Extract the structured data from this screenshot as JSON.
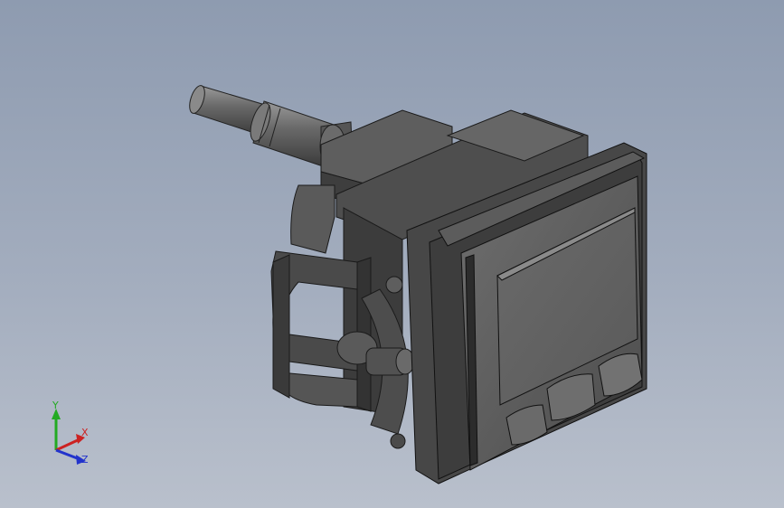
{
  "viewport": {
    "background_top": "#8e9bb0",
    "background_bottom": "#b9c0cc",
    "model_name": ""
  },
  "triad": {
    "x_label": "X",
    "y_label": "Y",
    "z_label": "Z",
    "x_color": "#cc2222",
    "y_color": "#22aa22",
    "z_color": "#2233cc"
  },
  "icons": [
    "pressure-sensor-model",
    "axis-triad-icon"
  ]
}
